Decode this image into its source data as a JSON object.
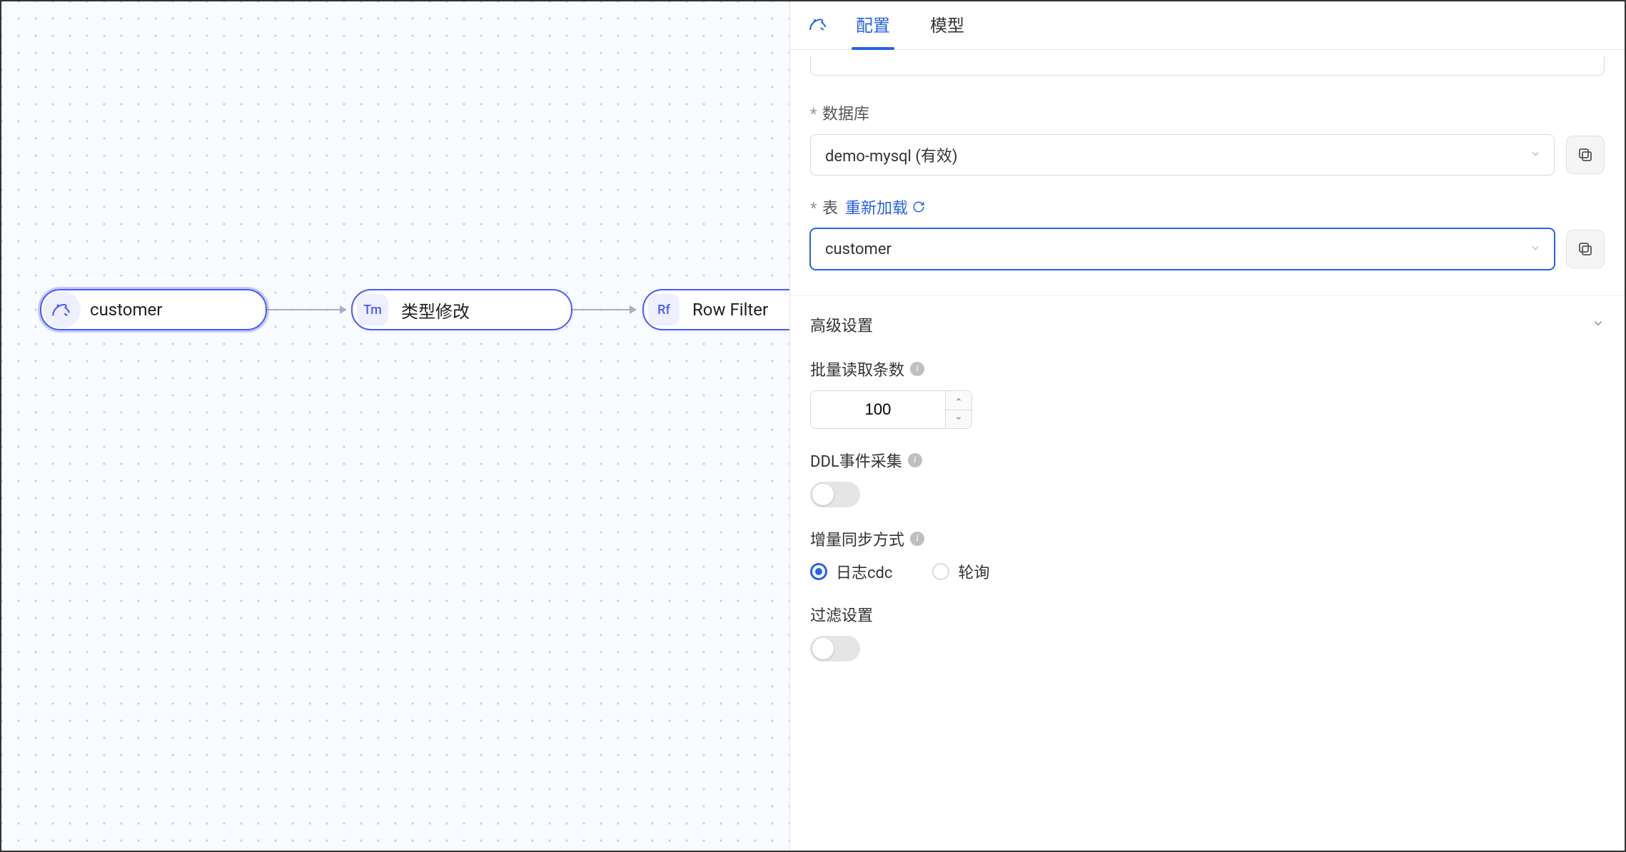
{
  "canvas": {
    "nodes": [
      {
        "id": "n1",
        "label": "customer",
        "badge": ""
      },
      {
        "id": "n2",
        "label": "类型修改",
        "badge": "Tm"
      },
      {
        "id": "n3",
        "label": "Row Filter",
        "badge": "Rf"
      }
    ]
  },
  "panel": {
    "tabs": {
      "config": "配置",
      "model": "模型"
    },
    "database": {
      "label": "数据库",
      "required_marker": "*",
      "value": "demo-mysql (有效)"
    },
    "table": {
      "label": "表",
      "required_marker": "*",
      "reload_label": "重新加载",
      "value": "customer"
    },
    "advanced": {
      "title": "高级设置",
      "batch_read": {
        "label": "批量读取条数",
        "value": "100"
      },
      "ddl_capture": {
        "label": "DDL事件采集",
        "value": false
      },
      "sync_method": {
        "label": "增量同步方式",
        "options": {
          "log_cdc": "日志cdc",
          "polling": "轮询"
        },
        "selected": "log_cdc"
      },
      "filter": {
        "label": "过滤设置",
        "value": false
      }
    }
  }
}
